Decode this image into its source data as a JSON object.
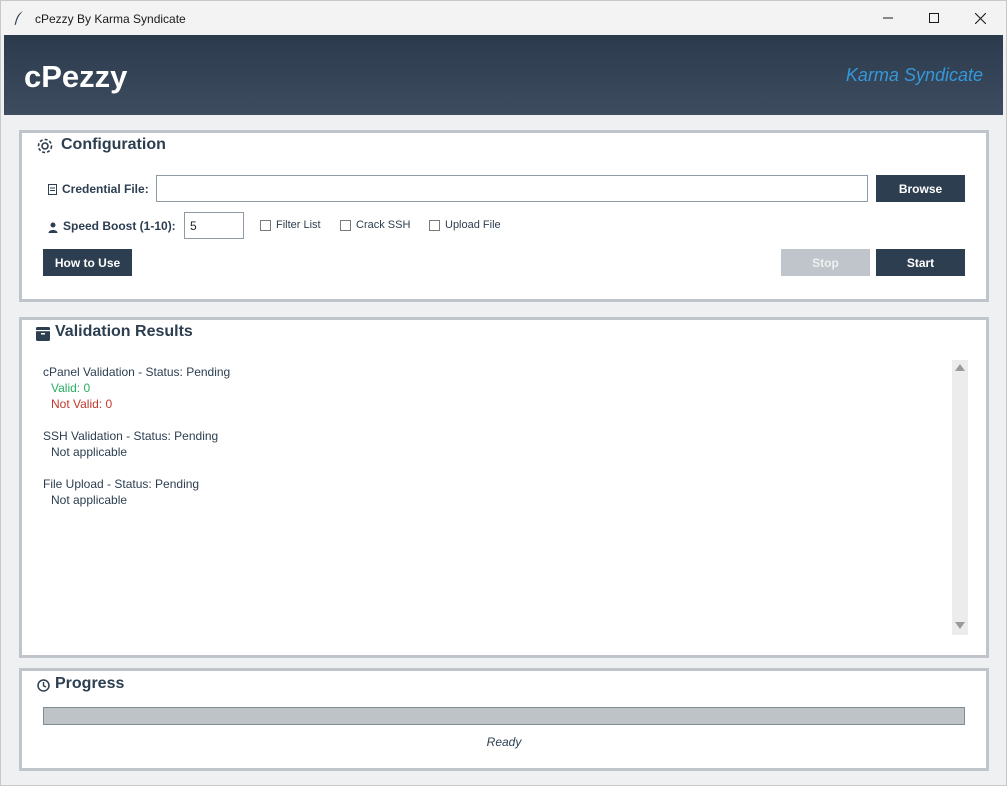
{
  "window": {
    "title": "cPezzy By Karma Syndicate",
    "icons": {
      "app": "feather-icon",
      "minimize": "minimize-icon",
      "maximize": "maximize-icon",
      "close": "close-icon"
    }
  },
  "header": {
    "app_name": "cPezzy",
    "brand": "Karma Syndicate"
  },
  "config": {
    "title": "Configuration",
    "credential_label": "Credential File:",
    "credential_value": "",
    "browse_label": "Browse",
    "speed_label": "Speed Boost (1-10):",
    "speed_value": "5",
    "checkboxes": [
      {
        "label": "Filter List",
        "checked": false
      },
      {
        "label": "Crack SSH",
        "checked": false
      },
      {
        "label": "Upload File",
        "checked": false
      }
    ],
    "how_to_label": "How to Use",
    "stop_label": "Stop",
    "start_label": "Start"
  },
  "results": {
    "title": "Validation Results",
    "cpanel_status": "cPanel Validation - Status: Pending",
    "cpanel_valid": "Valid: 0",
    "cpanel_not_valid": "Not Valid: 0",
    "ssh_status": "SSH Validation - Status: Pending",
    "ssh_detail": "Not applicable",
    "upload_status": "File Upload - Status: Pending",
    "upload_detail": "Not applicable"
  },
  "progress": {
    "title": "Progress",
    "value_percent": 0,
    "status": "Ready"
  },
  "colors": {
    "header_dark": "#2b3a4c",
    "accent_blue": "#3498db",
    "button": "#2c3e50",
    "valid_green": "#27ae60",
    "invalid_red": "#c0392b"
  }
}
